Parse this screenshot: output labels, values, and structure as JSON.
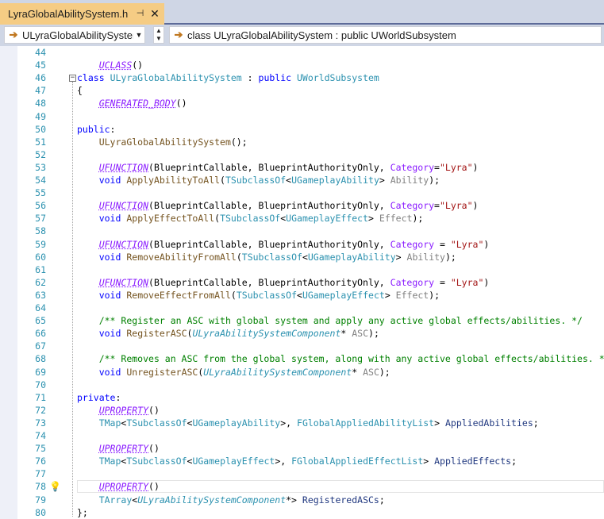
{
  "tab": {
    "title": "LyraGlobalAbilitySystem.h",
    "pin_glyph": "⊣",
    "close_glyph": "✕"
  },
  "navbar": {
    "scope_combo": "ULyraGlobalAbilitySysten",
    "member_combo": "class ULyraGlobalAbilitySystem : public UWorldSubsystem"
  },
  "icons": {
    "nav_arrow": "arrow-right-icon",
    "lightbulb": "lightbulb-icon",
    "collapse": "collapse-icon"
  },
  "colors": {
    "keyword": "#0000ff",
    "macro": "#8a1bff",
    "type": "#2b91af",
    "function": "#74531f",
    "string": "#a31515",
    "comment": "#008000",
    "line_number": "#2b91af",
    "tab_active": "#f5cc84"
  },
  "editor": {
    "lines": [
      {
        "n": "44",
        "tokens": []
      },
      {
        "n": "45",
        "tokens": [
          [
            "    ",
            ""
          ],
          [
            "UCLASS",
            "mac"
          ],
          [
            "()",
            ""
          ]
        ]
      },
      {
        "n": "46",
        "tokens": [
          [
            "class",
            "kw"
          ],
          [
            " ",
            ""
          ],
          [
            "ULyraGlobalAbilitySystem",
            "ty"
          ],
          [
            " : ",
            ""
          ],
          [
            "public",
            "kw"
          ],
          [
            " ",
            ""
          ],
          [
            "UWorldSubsystem",
            "ty"
          ]
        ]
      },
      {
        "n": "47",
        "tokens": [
          [
            "{",
            ""
          ]
        ]
      },
      {
        "n": "48",
        "tokens": [
          [
            "    ",
            ""
          ],
          [
            "GENERATED_BODY",
            "mac"
          ],
          [
            "()",
            ""
          ]
        ]
      },
      {
        "n": "49",
        "tokens": []
      },
      {
        "n": "50",
        "tokens": [
          [
            "public",
            "kw"
          ],
          [
            ":",
            ""
          ]
        ]
      },
      {
        "n": "51",
        "tokens": [
          [
            "    ",
            ""
          ],
          [
            "ULyraGlobalAbilitySystem",
            "fn"
          ],
          [
            "();",
            ""
          ]
        ]
      },
      {
        "n": "52",
        "tokens": []
      },
      {
        "n": "53",
        "tokens": [
          [
            "    ",
            ""
          ],
          [
            "UFUNCTION",
            "mac"
          ],
          [
            "(BlueprintCallable, BlueprintAuthorityOnly, ",
            ""
          ],
          [
            "Category",
            "cat"
          ],
          [
            "=",
            ""
          ],
          [
            "\"Lyra\"",
            "str"
          ],
          [
            ")",
            ""
          ]
        ]
      },
      {
        "n": "54",
        "tokens": [
          [
            "    ",
            ""
          ],
          [
            "void",
            "kw"
          ],
          [
            " ",
            ""
          ],
          [
            "ApplyAbilityToAll",
            "fn"
          ],
          [
            "(",
            ""
          ],
          [
            "TSubclassOf",
            "ty"
          ],
          [
            "<",
            ""
          ],
          [
            "UGameplayAbility",
            "ty"
          ],
          [
            "> ",
            ""
          ],
          [
            "Ability",
            "par"
          ],
          [
            ");",
            ""
          ]
        ]
      },
      {
        "n": "55",
        "tokens": []
      },
      {
        "n": "56",
        "tokens": [
          [
            "    ",
            ""
          ],
          [
            "UFUNCTION",
            "mac"
          ],
          [
            "(BlueprintCallable, BlueprintAuthorityOnly, ",
            ""
          ],
          [
            "Category",
            "cat"
          ],
          [
            "=",
            ""
          ],
          [
            "\"Lyra\"",
            "str"
          ],
          [
            ")",
            ""
          ]
        ]
      },
      {
        "n": "57",
        "tokens": [
          [
            "    ",
            ""
          ],
          [
            "void",
            "kw"
          ],
          [
            " ",
            ""
          ],
          [
            "ApplyEffectToAll",
            "fn"
          ],
          [
            "(",
            ""
          ],
          [
            "TSubclassOf",
            "ty"
          ],
          [
            "<",
            ""
          ],
          [
            "UGameplayEffect",
            "ty"
          ],
          [
            "> ",
            ""
          ],
          [
            "Effect",
            "par"
          ],
          [
            ");",
            ""
          ]
        ]
      },
      {
        "n": "58",
        "tokens": []
      },
      {
        "n": "59",
        "tokens": [
          [
            "    ",
            ""
          ],
          [
            "UFUNCTION",
            "mac"
          ],
          [
            "(BlueprintCallable, BlueprintAuthorityOnly, ",
            ""
          ],
          [
            "Category",
            "cat"
          ],
          [
            " = ",
            ""
          ],
          [
            "\"Lyra\"",
            "str"
          ],
          [
            ")",
            ""
          ]
        ]
      },
      {
        "n": "60",
        "tokens": [
          [
            "    ",
            ""
          ],
          [
            "void",
            "kw"
          ],
          [
            " ",
            ""
          ],
          [
            "RemoveAbilityFromAll",
            "fn"
          ],
          [
            "(",
            ""
          ],
          [
            "TSubclassOf",
            "ty"
          ],
          [
            "<",
            ""
          ],
          [
            "UGameplayAbility",
            "ty"
          ],
          [
            "> ",
            ""
          ],
          [
            "Ability",
            "par"
          ],
          [
            ");",
            ""
          ]
        ]
      },
      {
        "n": "61",
        "tokens": []
      },
      {
        "n": "62",
        "tokens": [
          [
            "    ",
            ""
          ],
          [
            "UFUNCTION",
            "mac"
          ],
          [
            "(BlueprintCallable, BlueprintAuthorityOnly, ",
            ""
          ],
          [
            "Category",
            "cat"
          ],
          [
            " = ",
            ""
          ],
          [
            "\"Lyra\"",
            "str"
          ],
          [
            ")",
            ""
          ]
        ]
      },
      {
        "n": "63",
        "tokens": [
          [
            "    ",
            ""
          ],
          [
            "void",
            "kw"
          ],
          [
            " ",
            ""
          ],
          [
            "RemoveEffectFromAll",
            "fn"
          ],
          [
            "(",
            ""
          ],
          [
            "TSubclassOf",
            "ty"
          ],
          [
            "<",
            ""
          ],
          [
            "UGameplayEffect",
            "ty"
          ],
          [
            "> ",
            ""
          ],
          [
            "Effect",
            "par"
          ],
          [
            ");",
            ""
          ]
        ]
      },
      {
        "n": "64",
        "tokens": []
      },
      {
        "n": "65",
        "tokens": [
          [
            "    ",
            ""
          ],
          [
            "/** Register an ASC with global system and apply any active global effects/abilities. */",
            "cm"
          ]
        ]
      },
      {
        "n": "66",
        "tokens": [
          [
            "    ",
            ""
          ],
          [
            "void",
            "kw"
          ],
          [
            " ",
            ""
          ],
          [
            "RegisterASC",
            "fn"
          ],
          [
            "(",
            ""
          ],
          [
            "ULyraAbilitySystemComponent",
            "ty-it"
          ],
          [
            "* ",
            ""
          ],
          [
            "ASC",
            "par"
          ],
          [
            ");",
            ""
          ]
        ]
      },
      {
        "n": "67",
        "tokens": []
      },
      {
        "n": "68",
        "tokens": [
          [
            "    ",
            ""
          ],
          [
            "/** Removes an ASC from the global system, along with any active global effects/abilities. */",
            "cm"
          ]
        ]
      },
      {
        "n": "69",
        "tokens": [
          [
            "    ",
            ""
          ],
          [
            "void",
            "kw"
          ],
          [
            " ",
            ""
          ],
          [
            "UnregisterASC",
            "fn"
          ],
          [
            "(",
            ""
          ],
          [
            "ULyraAbilitySystemComponent",
            "ty-it"
          ],
          [
            "* ",
            ""
          ],
          [
            "ASC",
            "par"
          ],
          [
            ");",
            ""
          ]
        ]
      },
      {
        "n": "70",
        "tokens": []
      },
      {
        "n": "71",
        "tokens": [
          [
            "private",
            "kw"
          ],
          [
            ":",
            ""
          ]
        ]
      },
      {
        "n": "72",
        "tokens": [
          [
            "    ",
            ""
          ],
          [
            "UPROPERTY",
            "mac"
          ],
          [
            "()",
            ""
          ]
        ]
      },
      {
        "n": "73",
        "tokens": [
          [
            "    ",
            ""
          ],
          [
            "TMap",
            "ty"
          ],
          [
            "<",
            ""
          ],
          [
            "TSubclassOf",
            "ty"
          ],
          [
            "<",
            ""
          ],
          [
            "UGameplayAbility",
            "ty"
          ],
          [
            ">, ",
            ""
          ],
          [
            "FGlobalAppliedAbilityList",
            "ty"
          ],
          [
            "> ",
            ""
          ],
          [
            "AppliedAbilities",
            "mbr"
          ],
          [
            ";",
            ""
          ]
        ]
      },
      {
        "n": "74",
        "tokens": []
      },
      {
        "n": "75",
        "tokens": [
          [
            "    ",
            ""
          ],
          [
            "UPROPERTY",
            "mac"
          ],
          [
            "()",
            ""
          ]
        ]
      },
      {
        "n": "76",
        "tokens": [
          [
            "    ",
            ""
          ],
          [
            "TMap",
            "ty"
          ],
          [
            "<",
            ""
          ],
          [
            "TSubclassOf",
            "ty"
          ],
          [
            "<",
            ""
          ],
          [
            "UGameplayEffect",
            "ty"
          ],
          [
            ">, ",
            ""
          ],
          [
            "FGlobalAppliedEffectList",
            "ty"
          ],
          [
            "> ",
            ""
          ],
          [
            "AppliedEffects",
            "mbr"
          ],
          [
            ";",
            ""
          ]
        ]
      },
      {
        "n": "77",
        "tokens": []
      },
      {
        "n": "78",
        "tokens": [
          [
            "    ",
            ""
          ],
          [
            "UPROPERTY",
            "mac"
          ],
          [
            "()",
            ""
          ]
        ]
      },
      {
        "n": "79",
        "tokens": [
          [
            "    ",
            ""
          ],
          [
            "TArray",
            "ty"
          ],
          [
            "<",
            ""
          ],
          [
            "ULyraAbilitySystemComponent",
            "ty-it"
          ],
          [
            "*> ",
            ""
          ],
          [
            "RegisteredASCs",
            "mbr"
          ],
          [
            ";",
            ""
          ]
        ]
      },
      {
        "n": "80",
        "tokens": [
          [
            "};",
            ""
          ]
        ]
      }
    ]
  }
}
